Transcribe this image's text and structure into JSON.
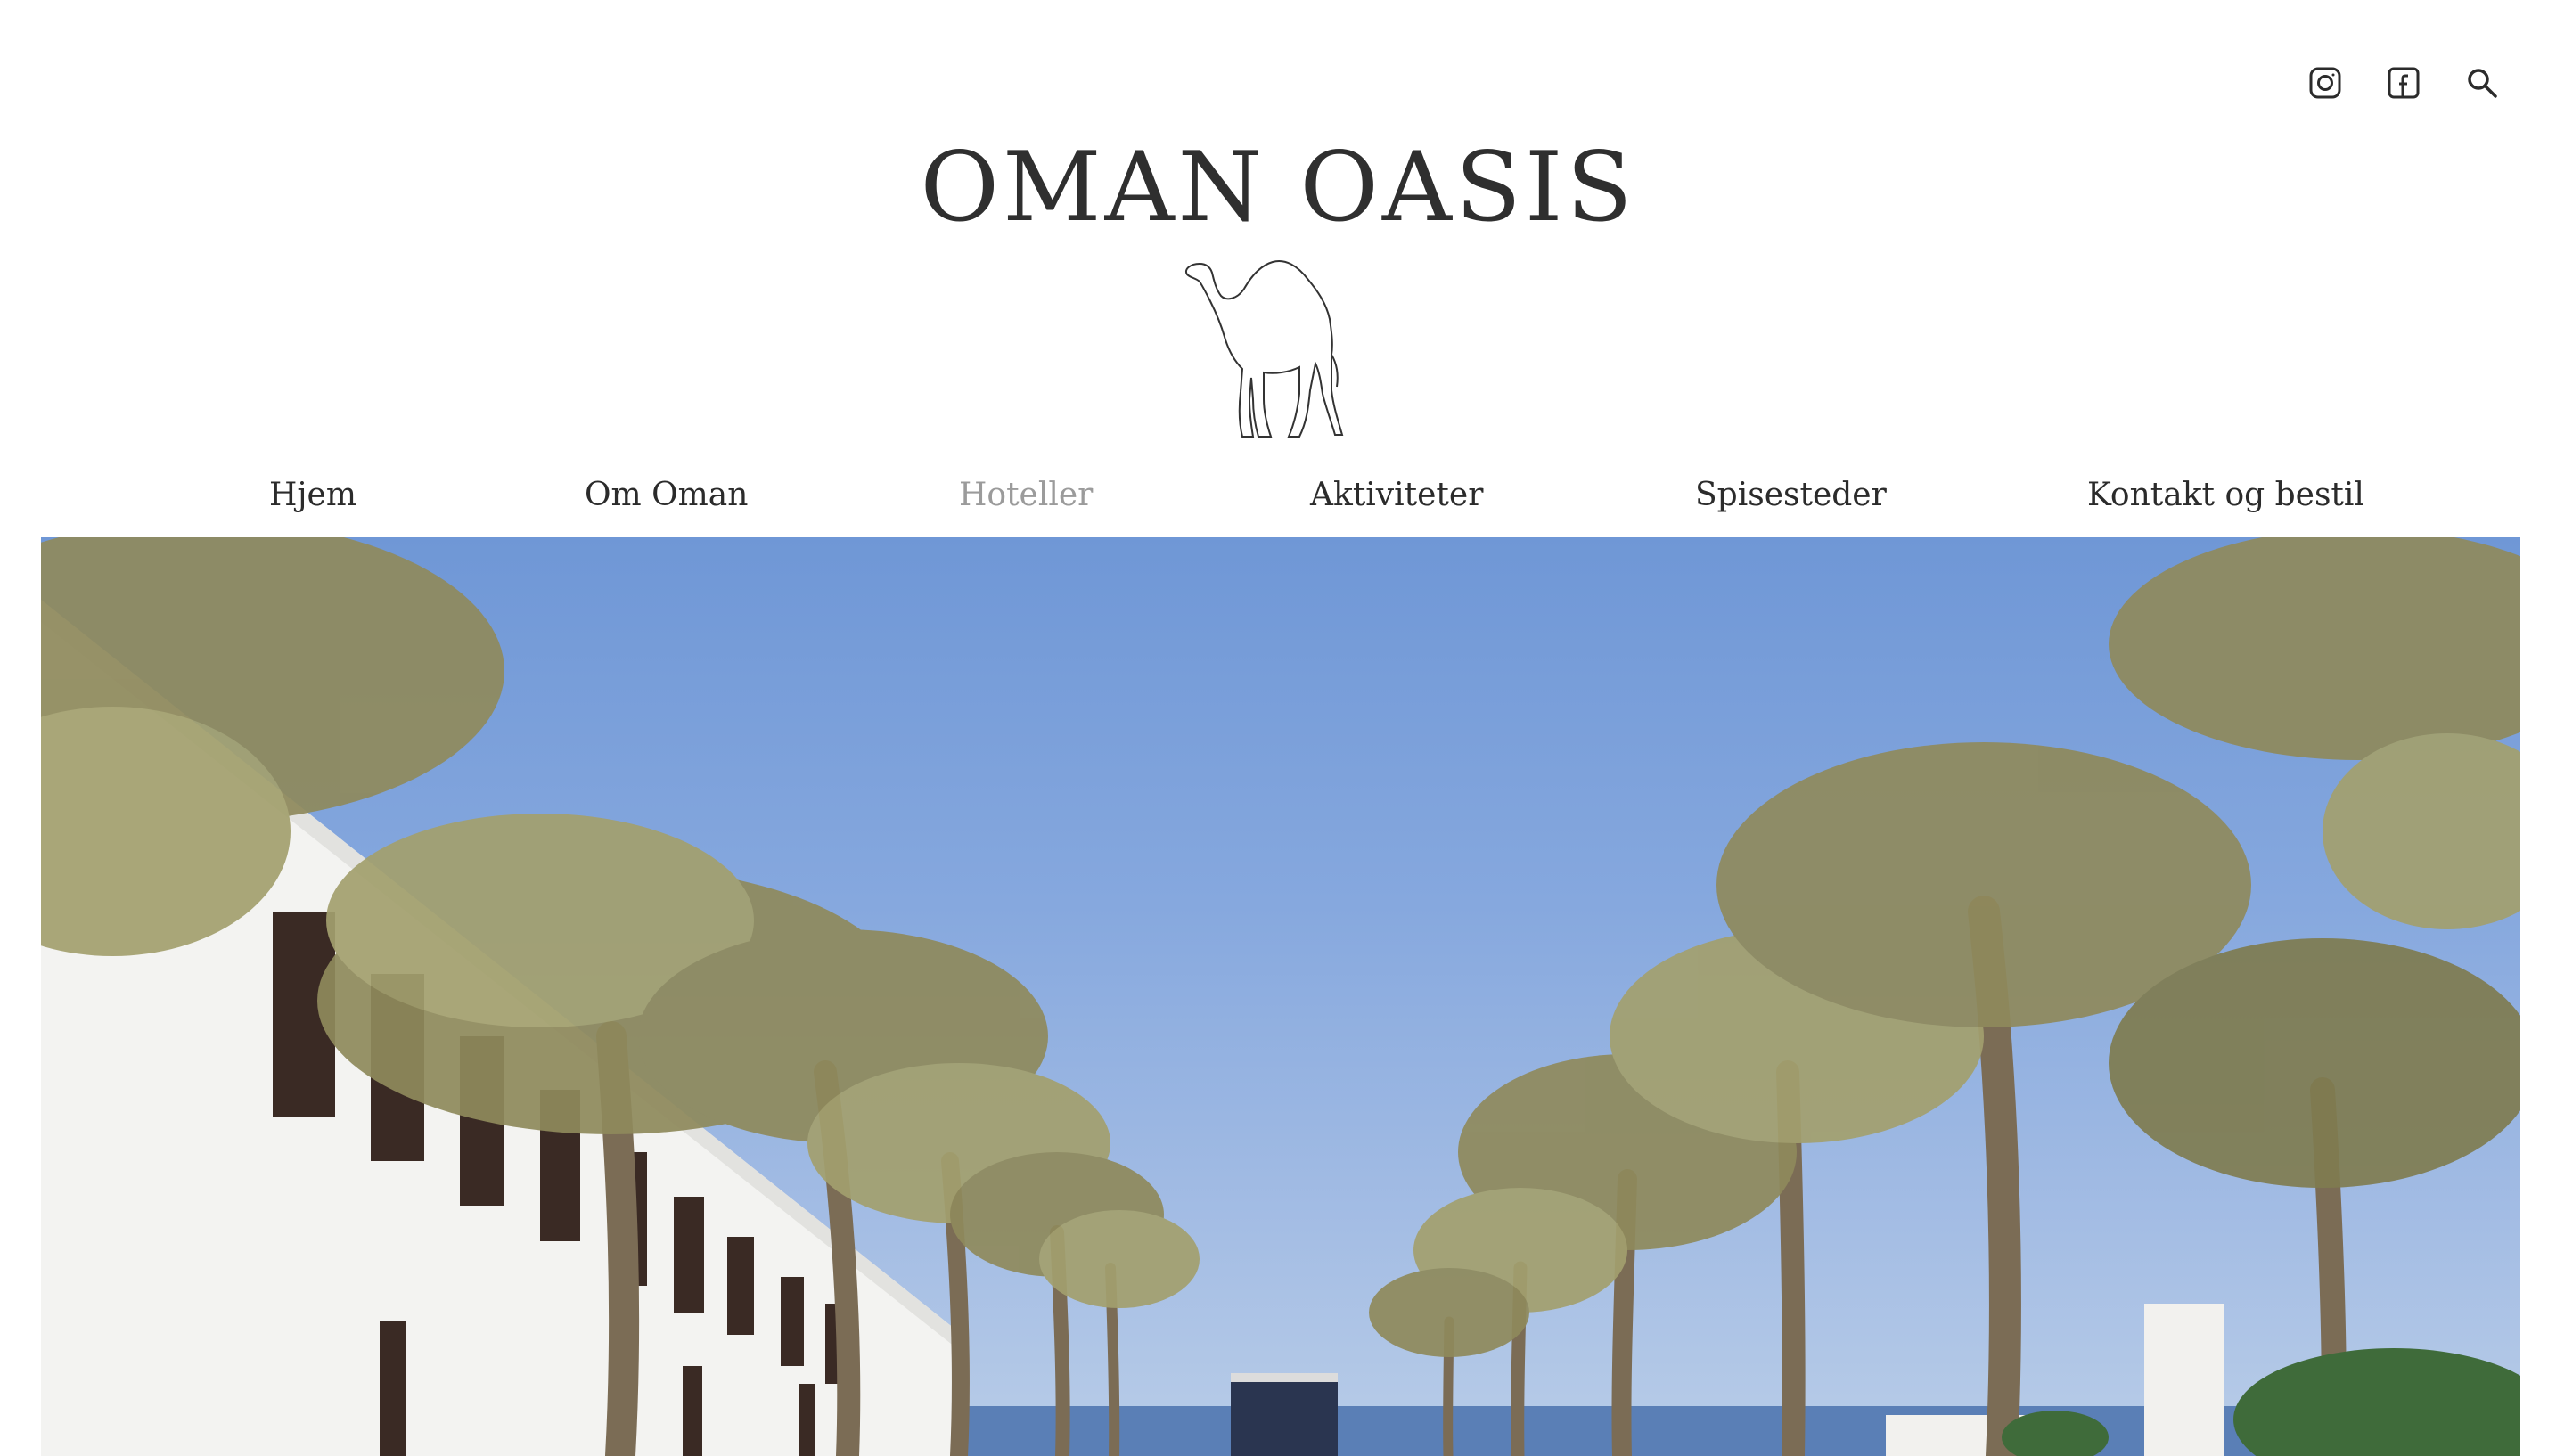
{
  "header": {
    "site_title": "OMAN OASIS",
    "icons": [
      "instagram-icon",
      "facebook-icon",
      "search-icon"
    ]
  },
  "nav": {
    "items": [
      {
        "label": "Hjem",
        "active": false
      },
      {
        "label": "Om Oman",
        "active": false
      },
      {
        "label": "Hoteller",
        "active": true
      },
      {
        "label": "Aktiviteter",
        "active": false
      },
      {
        "label": "Spisesteder",
        "active": false
      },
      {
        "label": "Kontakt og bestil",
        "active": false
      }
    ]
  },
  "colors": {
    "text": "#2b2b2b",
    "active_nav": "#9b9b9b",
    "sky": "#86a8de",
    "palm": "#8a8a5a",
    "building": "#f4f4f2"
  }
}
